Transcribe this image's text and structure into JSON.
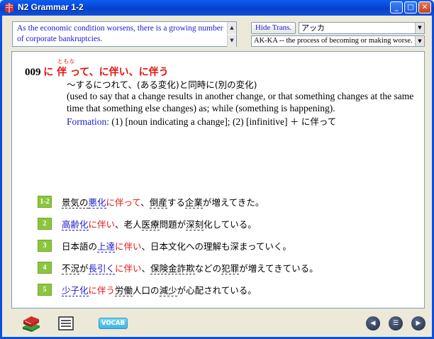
{
  "window": {
    "title": "N2 Grammar 1-2",
    "minimize_glyph": "_",
    "maximize_glyph": "□",
    "close_glyph": "✕"
  },
  "top": {
    "translation": "As the economic condition worsens, there is a growing number of corporate bankruptcies.",
    "hide_label": "Hide Trans.",
    "reading_value": "アッカ",
    "definition_value": "AK-KA -- the process of becoming or making worse."
  },
  "entry": {
    "number": "009",
    "title": "に 伴 って、に伴い、に伴う",
    "furigana": "ともな",
    "gloss_jp": "～するにつれて、(ある変化)と同時に(別の変化)",
    "gloss_en": "(used to say that a change results in another change, or that something changes at the same time that something else changes) as; while (something is happening).",
    "formation_label": "Formation:",
    "formation_text": "(1) [noun indicating a change]; (2) [infinitive]",
    "formation_plus": "＋",
    "formation_jp": "に伴って"
  },
  "examples": [
    {
      "badge": "1-2",
      "parts": [
        [
          "景気の",
          "v"
        ],
        [
          "悪化",
          "b"
        ],
        [
          "に伴って",
          "r"
        ],
        [
          "、",
          ""
        ],
        [
          "倒産",
          "v"
        ],
        [
          "する",
          ""
        ],
        [
          "企業",
          "v"
        ],
        [
          "が増えてきた。",
          ""
        ]
      ]
    },
    {
      "badge": "2",
      "parts": [
        [
          "高齢化",
          "b"
        ],
        [
          "に伴い",
          "r"
        ],
        [
          "、老人",
          ""
        ],
        [
          "医療",
          "v"
        ],
        [
          "問題が",
          ""
        ],
        [
          "深刻",
          "v"
        ],
        [
          "化している。",
          ""
        ]
      ]
    },
    {
      "badge": "3",
      "parts": [
        [
          "日本語の",
          ""
        ],
        [
          "上達",
          "b"
        ],
        [
          "に伴い",
          "r"
        ],
        [
          "、日本文化への理解も深まっていく。",
          ""
        ]
      ]
    },
    {
      "badge": "4",
      "parts": [
        [
          "不況",
          "v"
        ],
        [
          "が",
          ""
        ],
        [
          "長引く",
          "b"
        ],
        [
          "に伴い",
          "r"
        ],
        [
          "、",
          ""
        ],
        [
          "保険金詐欺",
          "v"
        ],
        [
          "などの",
          ""
        ],
        [
          "犯罪",
          "v"
        ],
        [
          "が増えてきている。",
          ""
        ]
      ]
    },
    {
      "badge": "5",
      "parts": [
        [
          "少子化",
          "b"
        ],
        [
          "に伴う",
          "r"
        ],
        [
          "労働",
          "v"
        ],
        [
          "人口の",
          ""
        ],
        [
          "減少",
          "v"
        ],
        [
          "が心配されている。",
          ""
        ]
      ]
    }
  ],
  "toolbar": {
    "vocab_label": "VOCAB",
    "back_glyph": "◀",
    "list_glyph": "☰",
    "forward_glyph": "▶"
  },
  "colors": {
    "accent_red": "#e5120f",
    "accent_blue": "#1a1ad0",
    "badge_green": "#8cc63f",
    "vocab_cyan": "#3fb4e3"
  }
}
